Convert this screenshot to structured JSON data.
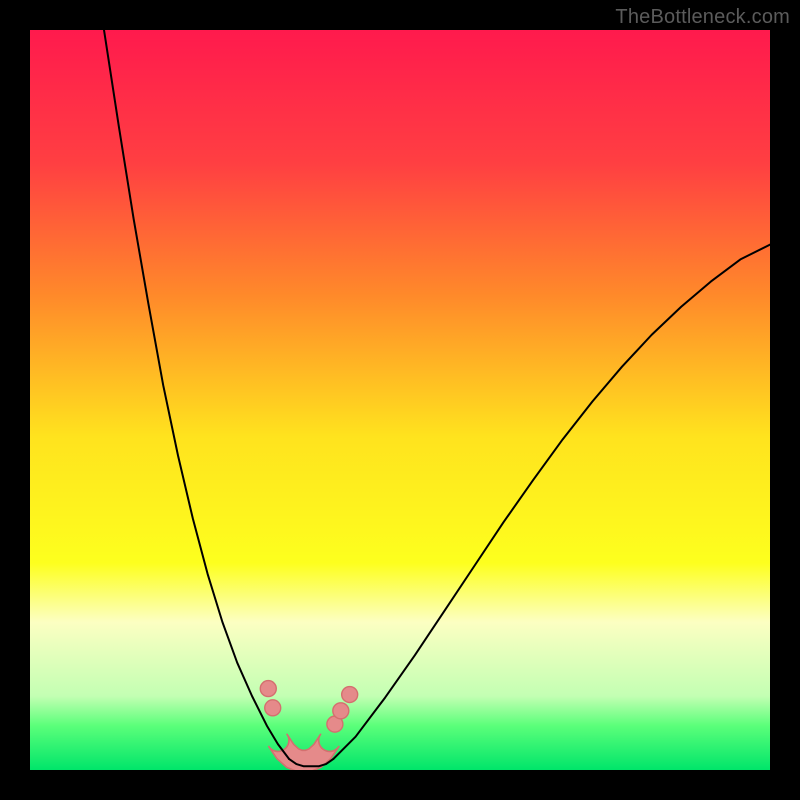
{
  "watermark": "TheBottleneck.com",
  "chart_data": {
    "type": "line",
    "title": "",
    "xlabel": "",
    "ylabel": "",
    "xlim": [
      0,
      100
    ],
    "ylim": [
      0,
      100
    ],
    "grid": false,
    "background": {
      "stops": [
        {
          "offset": 0.0,
          "color": "#ff1a4d"
        },
        {
          "offset": 0.18,
          "color": "#ff3f42"
        },
        {
          "offset": 0.36,
          "color": "#ff8a2a"
        },
        {
          "offset": 0.55,
          "color": "#ffe31e"
        },
        {
          "offset": 0.72,
          "color": "#fdff1e"
        },
        {
          "offset": 0.8,
          "color": "#fcffc2"
        },
        {
          "offset": 0.9,
          "color": "#c3ffb3"
        },
        {
          "offset": 0.94,
          "color": "#5bff7a"
        },
        {
          "offset": 1.0,
          "color": "#00e56a"
        }
      ]
    },
    "series": [
      {
        "name": "left-curve",
        "color": "#000000",
        "width": 2,
        "x": [
          10.0,
          12.0,
          14.0,
          16.0,
          18.0,
          20.0,
          22.0,
          24.0,
          26.0,
          28.0,
          30.0,
          32.0,
          33.5,
          35.0
        ],
        "values": [
          100.0,
          87.0,
          74.5,
          63.0,
          52.0,
          42.5,
          34.0,
          26.5,
          20.0,
          14.5,
          10.0,
          6.0,
          3.5,
          1.5
        ]
      },
      {
        "name": "valley-floor",
        "color": "#000000",
        "width": 2,
        "x": [
          35.0,
          36.0,
          37.0,
          38.0,
          39.0,
          40.0,
          41.0
        ],
        "values": [
          1.5,
          0.8,
          0.5,
          0.5,
          0.5,
          0.8,
          1.5
        ]
      },
      {
        "name": "right-curve",
        "color": "#000000",
        "width": 2,
        "x": [
          41.0,
          44.0,
          48.0,
          52.0,
          56.0,
          60.0,
          64.0,
          68.0,
          72.0,
          76.0,
          80.0,
          84.0,
          88.0,
          92.0,
          96.0,
          100.0
        ],
        "values": [
          1.5,
          4.5,
          9.8,
          15.5,
          21.5,
          27.5,
          33.5,
          39.2,
          44.7,
          49.8,
          54.5,
          58.8,
          62.6,
          66.0,
          69.0,
          71.0
        ]
      }
    ],
    "markers": {
      "name": "dip-markers",
      "color": "#e58a8a",
      "stroke": "#d46f6f",
      "radius": 8,
      "points": [
        {
          "x": 32.2,
          "y": 11.0
        },
        {
          "x": 32.8,
          "y": 8.4
        },
        {
          "x": 41.2,
          "y": 6.2
        },
        {
          "x": 42.0,
          "y": 8.0
        },
        {
          "x": 43.2,
          "y": 10.2
        }
      ]
    },
    "sausage": {
      "name": "dip-sausage",
      "fill": "#e58a8a",
      "stroke": "#d46f6f",
      "stroke_width": 1.6,
      "half_width": 11,
      "x": [
        33.5,
        34.5,
        35.5,
        36.5,
        37.5,
        38.5,
        39.5,
        40.5
      ],
      "values": [
        4.0,
        2.5,
        1.6,
        1.2,
        1.2,
        1.6,
        2.5,
        4.0
      ]
    }
  }
}
